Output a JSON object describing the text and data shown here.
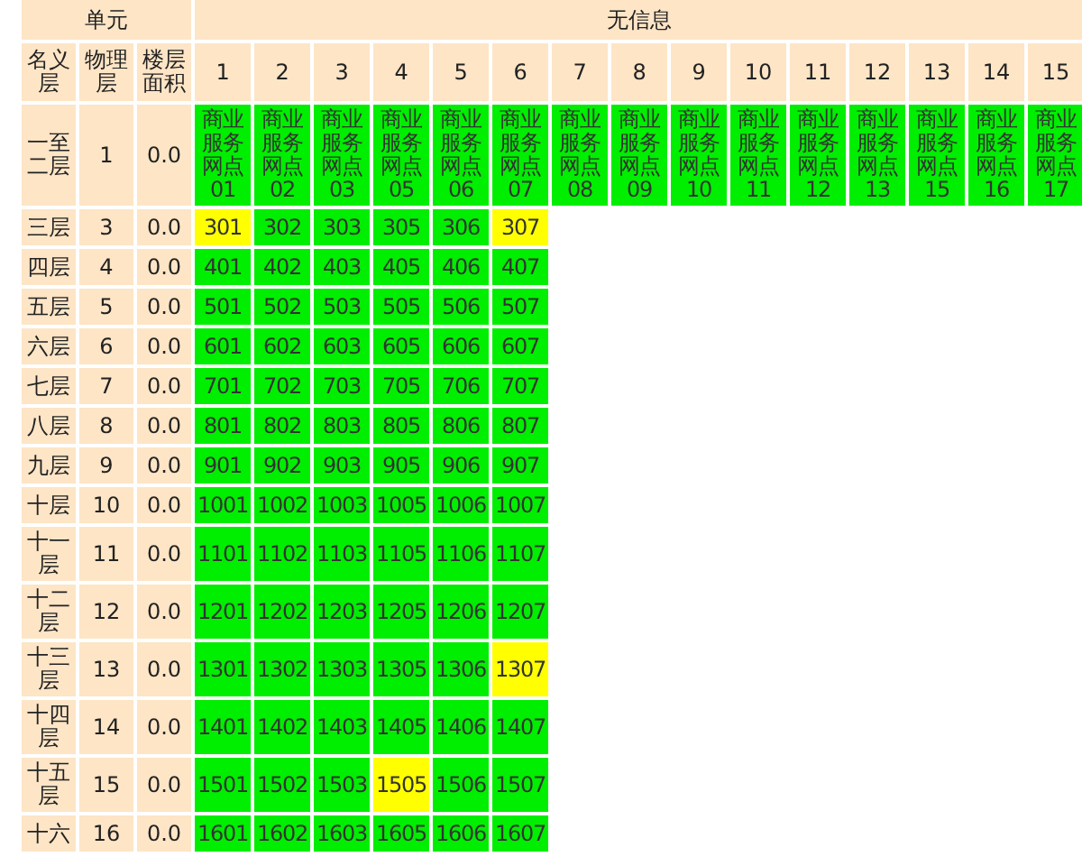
{
  "header": {
    "unit_label": "单元",
    "group_label": "无信息",
    "columns": [
      "名义层",
      "物理层",
      "楼层面积"
    ],
    "unit_numbers": [
      "1",
      "2",
      "3",
      "4",
      "5",
      "6",
      "7",
      "8",
      "9",
      "10",
      "11",
      "12",
      "13",
      "14",
      "15"
    ]
  },
  "rows": [
    {
      "nominal": "一至二层",
      "physical": "1",
      "area": "0.0",
      "rooms": [
        {
          "label": "商业服务网点01",
          "color": "#00ee00"
        },
        {
          "label": "商业服务网点02",
          "color": "#00ee00"
        },
        {
          "label": "商业服务网点03",
          "color": "#00ee00"
        },
        {
          "label": "商业服务网点05",
          "color": "#00ee00"
        },
        {
          "label": "商业服务网点06",
          "color": "#00ee00"
        },
        {
          "label": "商业服务网点07",
          "color": "#00ee00"
        },
        {
          "label": "商业服务网点08",
          "color": "#00ee00"
        },
        {
          "label": "商业服务网点09",
          "color": "#00ee00"
        },
        {
          "label": "商业服务网点10",
          "color": "#00ee00"
        },
        {
          "label": "商业服务网点11",
          "color": "#00ee00"
        },
        {
          "label": "商业服务网点12",
          "color": "#00ee00"
        },
        {
          "label": "商业服务网点13",
          "color": "#00ee00"
        },
        {
          "label": "商业服务网点15",
          "color": "#00ee00"
        },
        {
          "label": "商业服务网点16",
          "color": "#00ee00"
        },
        {
          "label": "商业服务网点17",
          "color": "#00ee00"
        }
      ]
    },
    {
      "nominal": "三层",
      "physical": "3",
      "area": "0.0",
      "rooms": [
        {
          "label": "301",
          "color": "#ffff00"
        },
        {
          "label": "302",
          "color": "#00ee00"
        },
        {
          "label": "303",
          "color": "#00ee00"
        },
        {
          "label": "305",
          "color": "#00ee00"
        },
        {
          "label": "306",
          "color": "#00ee00"
        },
        {
          "label": "307",
          "color": "#ffff00"
        }
      ]
    },
    {
      "nominal": "四层",
      "physical": "4",
      "area": "0.0",
      "rooms": [
        {
          "label": "401",
          "color": "#00ee00"
        },
        {
          "label": "402",
          "color": "#00ee00"
        },
        {
          "label": "403",
          "color": "#00ee00"
        },
        {
          "label": "405",
          "color": "#00ee00"
        },
        {
          "label": "406",
          "color": "#00ee00"
        },
        {
          "label": "407",
          "color": "#00ee00"
        }
      ]
    },
    {
      "nominal": "五层",
      "physical": "5",
      "area": "0.0",
      "rooms": [
        {
          "label": "501",
          "color": "#00ee00"
        },
        {
          "label": "502",
          "color": "#00ee00"
        },
        {
          "label": "503",
          "color": "#00ee00"
        },
        {
          "label": "505",
          "color": "#00ee00"
        },
        {
          "label": "506",
          "color": "#00ee00"
        },
        {
          "label": "507",
          "color": "#00ee00"
        }
      ]
    },
    {
      "nominal": "六层",
      "physical": "6",
      "area": "0.0",
      "rooms": [
        {
          "label": "601",
          "color": "#00ee00"
        },
        {
          "label": "602",
          "color": "#00ee00"
        },
        {
          "label": "603",
          "color": "#00ee00"
        },
        {
          "label": "605",
          "color": "#00ee00"
        },
        {
          "label": "606",
          "color": "#00ee00"
        },
        {
          "label": "607",
          "color": "#00ee00"
        }
      ]
    },
    {
      "nominal": "七层",
      "physical": "7",
      "area": "0.0",
      "rooms": [
        {
          "label": "701",
          "color": "#00ee00"
        },
        {
          "label": "702",
          "color": "#00ee00"
        },
        {
          "label": "703",
          "color": "#00ee00"
        },
        {
          "label": "705",
          "color": "#00ee00"
        },
        {
          "label": "706",
          "color": "#00ee00"
        },
        {
          "label": "707",
          "color": "#00ee00"
        }
      ]
    },
    {
      "nominal": "八层",
      "physical": "8",
      "area": "0.0",
      "rooms": [
        {
          "label": "801",
          "color": "#00ee00"
        },
        {
          "label": "802",
          "color": "#00ee00"
        },
        {
          "label": "803",
          "color": "#00ee00"
        },
        {
          "label": "805",
          "color": "#00ee00"
        },
        {
          "label": "806",
          "color": "#00ee00"
        },
        {
          "label": "807",
          "color": "#00ee00"
        }
      ]
    },
    {
      "nominal": "九层",
      "physical": "9",
      "area": "0.0",
      "rooms": [
        {
          "label": "901",
          "color": "#00ee00"
        },
        {
          "label": "902",
          "color": "#00ee00"
        },
        {
          "label": "903",
          "color": "#00ee00"
        },
        {
          "label": "905",
          "color": "#00ee00"
        },
        {
          "label": "906",
          "color": "#00ee00"
        },
        {
          "label": "907",
          "color": "#00ee00"
        }
      ]
    },
    {
      "nominal": "十层",
      "physical": "10",
      "area": "0.0",
      "rooms": [
        {
          "label": "1001",
          "color": "#00ee00"
        },
        {
          "label": "1002",
          "color": "#00ee00"
        },
        {
          "label": "1003",
          "color": "#00ee00"
        },
        {
          "label": "1005",
          "color": "#00ee00"
        },
        {
          "label": "1006",
          "color": "#00ee00"
        },
        {
          "label": "1007",
          "color": "#00ee00"
        }
      ]
    },
    {
      "nominal": "十一层",
      "physical": "11",
      "area": "0.0",
      "rooms": [
        {
          "label": "1101",
          "color": "#00ee00"
        },
        {
          "label": "1102",
          "color": "#00ee00"
        },
        {
          "label": "1103",
          "color": "#00ee00"
        },
        {
          "label": "1105",
          "color": "#00ee00"
        },
        {
          "label": "1106",
          "color": "#00ee00"
        },
        {
          "label": "1107",
          "color": "#00ee00"
        }
      ]
    },
    {
      "nominal": "十二层",
      "physical": "12",
      "area": "0.0",
      "rooms": [
        {
          "label": "1201",
          "color": "#00ee00"
        },
        {
          "label": "1202",
          "color": "#00ee00"
        },
        {
          "label": "1203",
          "color": "#00ee00"
        },
        {
          "label": "1205",
          "color": "#00ee00"
        },
        {
          "label": "1206",
          "color": "#00ee00"
        },
        {
          "label": "1207",
          "color": "#00ee00"
        }
      ]
    },
    {
      "nominal": "十三层",
      "physical": "13",
      "area": "0.0",
      "rooms": [
        {
          "label": "1301",
          "color": "#00ee00"
        },
        {
          "label": "1302",
          "color": "#00ee00"
        },
        {
          "label": "1303",
          "color": "#00ee00"
        },
        {
          "label": "1305",
          "color": "#00ee00"
        },
        {
          "label": "1306",
          "color": "#00ee00"
        },
        {
          "label": "1307",
          "color": "#ffff00"
        }
      ]
    },
    {
      "nominal": "十四层",
      "physical": "14",
      "area": "0.0",
      "rooms": [
        {
          "label": "1401",
          "color": "#00ee00"
        },
        {
          "label": "1402",
          "color": "#00ee00"
        },
        {
          "label": "1403",
          "color": "#00ee00"
        },
        {
          "label": "1405",
          "color": "#00ee00"
        },
        {
          "label": "1406",
          "color": "#00ee00"
        },
        {
          "label": "1407",
          "color": "#00ee00"
        }
      ]
    },
    {
      "nominal": "十五层",
      "physical": "15",
      "area": "0.0",
      "rooms": [
        {
          "label": "1501",
          "color": "#00ee00"
        },
        {
          "label": "1502",
          "color": "#00ee00"
        },
        {
          "label": "1503",
          "color": "#00ee00"
        },
        {
          "label": "1505",
          "color": "#ffff00"
        },
        {
          "label": "1506",
          "color": "#00ee00"
        },
        {
          "label": "1507",
          "color": "#00ee00"
        }
      ]
    },
    {
      "nominal": "十六",
      "physical": "16",
      "area": "0.0",
      "rooms": [
        {
          "label": "1601",
          "color": "#00ee00"
        },
        {
          "label": "1602",
          "color": "#00ee00"
        },
        {
          "label": "1603",
          "color": "#00ee00"
        },
        {
          "label": "1605",
          "color": "#00ee00"
        },
        {
          "label": "1606",
          "color": "#00ee00"
        },
        {
          "label": "1607",
          "color": "#00ee00"
        }
      ]
    }
  ]
}
